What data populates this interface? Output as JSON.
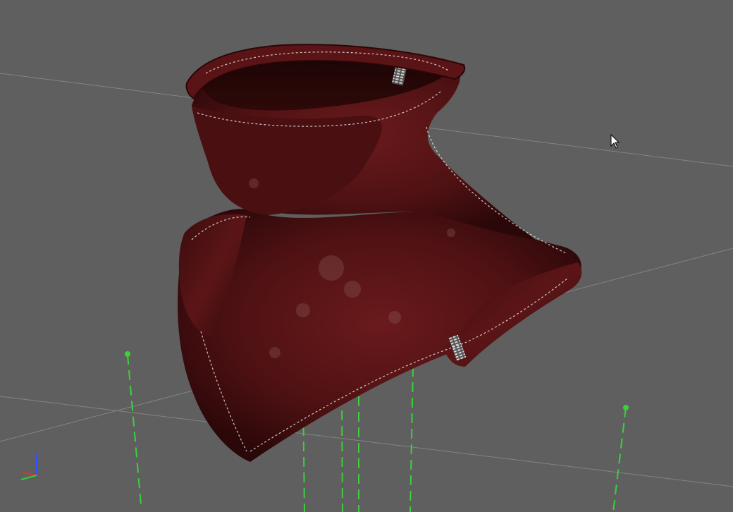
{
  "viewport": {
    "title": "",
    "background_color": "#5f5f5f",
    "grid_color": "#8a8a8a",
    "model_name_icon": "leather-neck-corset-model",
    "model_color": "#5a1416",
    "stitch_color": "#e8e8e8",
    "helper_color": "#3ad13a"
  },
  "gizmo": {
    "x_color": "#e03030",
    "y_color": "#30d030",
    "z_color": "#3050ff",
    "icon": "axis-gizmo-icon"
  },
  "cursor": {
    "icon": "mouse-pointer-icon"
  }
}
